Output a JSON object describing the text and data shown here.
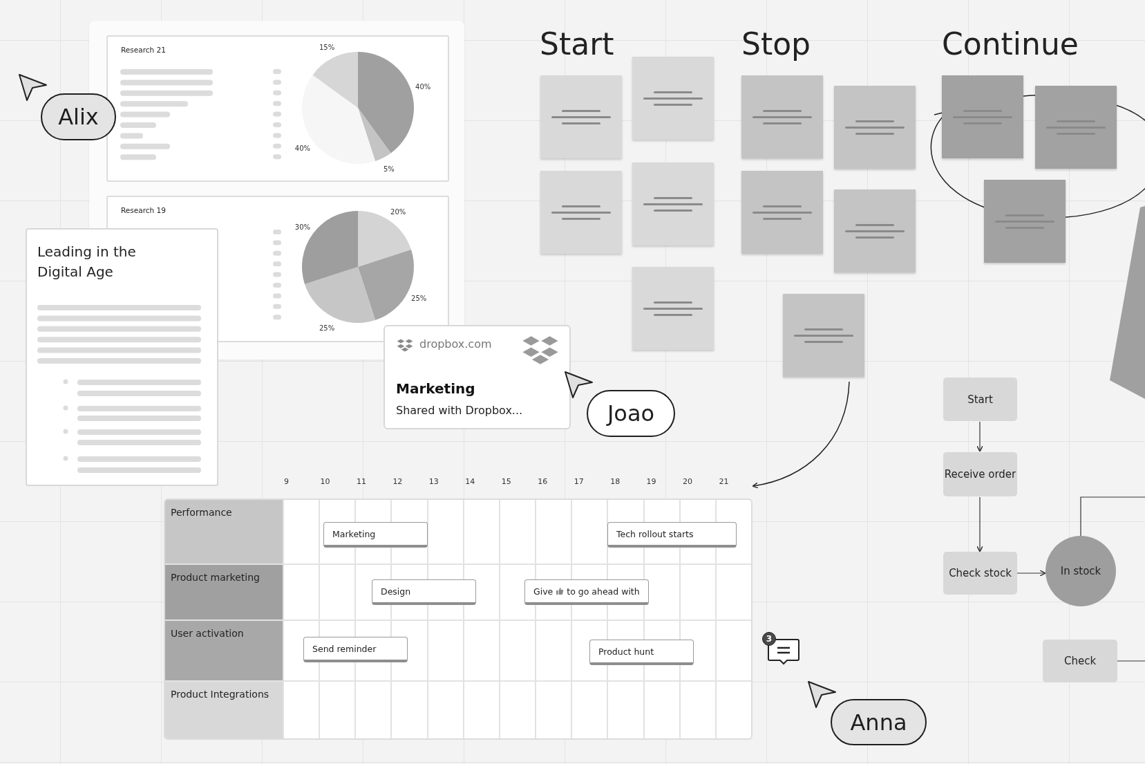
{
  "research_cards": [
    {
      "title": "Research 21",
      "chart_data": {
        "type": "pie",
        "values": [
          40,
          5,
          40,
          15
        ],
        "colors": [
          "#a0a0a0",
          "#c4c4c4",
          "#f6f6f6",
          "#d6d6d6"
        ],
        "value_labels": [
          "40%",
          "5%",
          "40%",
          "15%"
        ]
      }
    },
    {
      "title": "Research 19",
      "chart_data": {
        "type": "pie",
        "values": [
          20,
          25,
          25,
          30
        ],
        "colors": [
          "#d4d4d4",
          "#a6a6a6",
          "#c6c6c6",
          "#9e9e9e"
        ],
        "value_labels": [
          "20%",
          "25%",
          "25%",
          "30%"
        ]
      }
    }
  ],
  "document": {
    "title": "Leading in the Digital Age"
  },
  "link_card": {
    "domain": "dropbox.com",
    "title": "Marketing",
    "subtitle": "Shared with Dropbox..."
  },
  "cursors": [
    {
      "name": "Alix"
    },
    {
      "name": "Joao"
    },
    {
      "name": "Anna"
    }
  ],
  "retro_columns": [
    {
      "heading": "Start",
      "color": "#d9d9d9"
    },
    {
      "heading": "Stop",
      "color": "#c4c4c4"
    },
    {
      "heading": "Continue",
      "color": "#a2a2a2"
    }
  ],
  "flowchart": [
    {
      "kind": "box",
      "label": "Start"
    },
    {
      "kind": "box",
      "label": "Receive order"
    },
    {
      "kind": "box",
      "label": "Check stock"
    },
    {
      "kind": "circle",
      "label": "In stock"
    },
    {
      "kind": "box",
      "label": "Check"
    }
  ],
  "timeline": {
    "columns": [
      "9",
      "10",
      "11",
      "12",
      "13",
      "14",
      "15",
      "16",
      "17",
      "18",
      "19",
      "20",
      "21"
    ],
    "rows": [
      {
        "label": "Performance",
        "color": "#c6c6c6",
        "events": [
          {
            "parts": [
              "Marketing"
            ]
          },
          {
            "parts": [
              "Tech rollout starts"
            ]
          }
        ]
      },
      {
        "label": "Product marketing",
        "color": "#a0a0a0",
        "events": [
          {
            "parts": [
              "Design"
            ]
          },
          {
            "parts": [
              "Give",
              "to go ahead with"
            ]
          }
        ]
      },
      {
        "label": "User activation",
        "color": "#a8a8a8",
        "events": [
          {
            "parts": [
              "Send reminder"
            ]
          },
          {
            "parts": [
              "Product hunt"
            ]
          }
        ]
      },
      {
        "label": "Product Integrations",
        "color": "#d8d8d8",
        "events": []
      }
    ]
  },
  "comment": {
    "count": "3"
  }
}
